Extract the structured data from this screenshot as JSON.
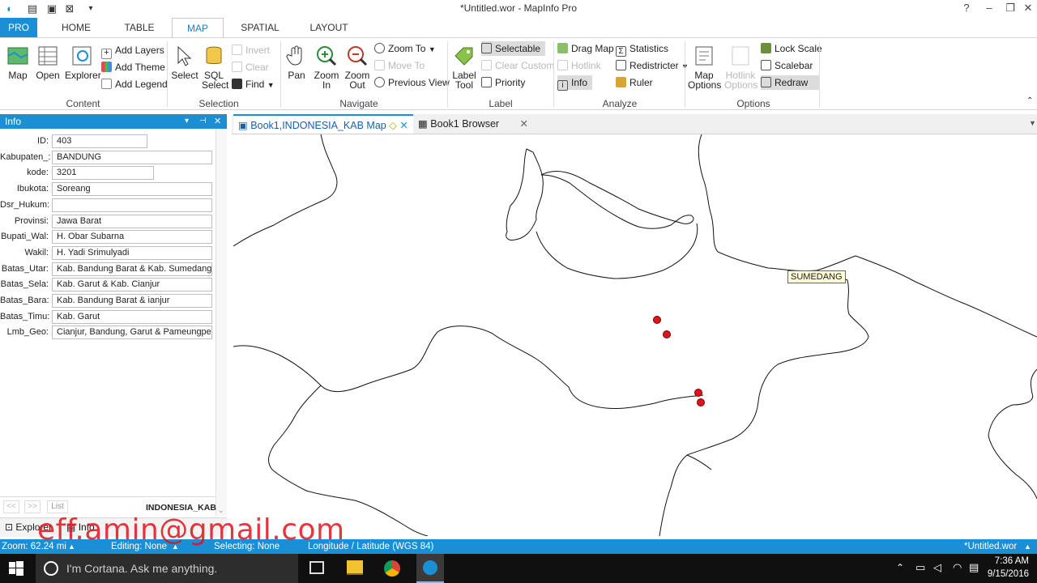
{
  "window": {
    "title": "*Untitled.wor - MapInfo Pro"
  },
  "ribbon_tabs": [
    "PRO",
    "HOME",
    "TABLE",
    "MAP",
    "SPATIAL",
    "LAYOUT"
  ],
  "ribbon": {
    "content": {
      "label": "Content",
      "map": "Map",
      "open": "Open",
      "explorer": "Explorer",
      "add_layers": "Add Layers",
      "add_theme": "Add Theme",
      "add_legend": "Add Legend"
    },
    "selection": {
      "label": "Selection",
      "select": "Select",
      "sql_select": "SQL Select",
      "invert": "Invert",
      "clear": "Clear",
      "find": "Find"
    },
    "navigate": {
      "label": "Navigate",
      "pan": "Pan",
      "zoom_in": "Zoom In",
      "zoom_out": "Zoom Out",
      "zoom_to": "Zoom To",
      "move_to": "Move To",
      "previous_view": "Previous View"
    },
    "label": {
      "label": "Label",
      "label_tool": "Label Tool",
      "selectable": "Selectable",
      "clear_custom": "Clear Custom",
      "priority": "Priority"
    },
    "analyze": {
      "label": "Analyze",
      "drag_map": "Drag Map",
      "hotlink": "Hotlink",
      "info": "Info",
      "statistics": "Statistics",
      "redistricter": "Redistricter",
      "ruler": "Ruler"
    },
    "options": {
      "label": "Options",
      "map_options": "Map Options",
      "hotlink_options": "Hotlink Options",
      "lock_scale": "Lock Scale",
      "scalebar": "Scalebar",
      "redraw": "Redraw"
    }
  },
  "info_panel": {
    "title": "Info",
    "fields": [
      {
        "label": "ID:",
        "value": "403"
      },
      {
        "label": "Kabupaten_:",
        "value": "BANDUNG"
      },
      {
        "label": "kode:",
        "value": "3201"
      },
      {
        "label": "Ibukota:",
        "value": "Soreang"
      },
      {
        "label": "Dsr_Hukum:",
        "value": ""
      },
      {
        "label": "Provinsi:",
        "value": "Jawa Barat"
      },
      {
        "label": "Bupati_Wal:",
        "value": "H. Obar Subarna"
      },
      {
        "label": "Wakil:",
        "value": "H. Yadi Srimulyadi"
      },
      {
        "label": "Batas_Utar:",
        "value": "Kab. Bandung Barat & Kab. Sumedang"
      },
      {
        "label": "Batas_Sela:",
        "value": "Kab. Garut & Kab. Cianjur"
      },
      {
        "label": "Batas_Bara:",
        "value": "Kab. Bandung Barat & ianjur"
      },
      {
        "label": "Batas_Timu:",
        "value": "Kab. Garut"
      },
      {
        "label": "Lmb_Geo:",
        "value": "Cianjur, Bandung, Garut & Pameungpeuk, S"
      }
    ],
    "nav_prev": "<<",
    "nav_next": ">>",
    "nav_list": "List",
    "table_name": "INDONESIA_KAB",
    "bottom_tabs": [
      "Explorer",
      "Info"
    ]
  },
  "doc_tabs": [
    {
      "label": "Book1,INDONESIA_KAB Map",
      "active": true
    },
    {
      "label": "Book1 Browser",
      "active": false
    }
  ],
  "map": {
    "label_sumedang": "SUMEDANG",
    "point_color": "#e0131b"
  },
  "status": {
    "zoom": "Zoom: 62.24 mi",
    "editing": "Editing: None",
    "selecting": "Selecting: None",
    "projection": "Longitude / Latitude (WGS 84)",
    "workspace": "*Untitled.wor"
  },
  "taskbar": {
    "cortana": "I'm Cortana. Ask me anything.",
    "time": "7:36 AM",
    "date": "9/15/2016"
  },
  "watermark": "eff.amin@gmail.com",
  "colors": {
    "accent": "#1b8fd6",
    "taskbar": "#101010"
  }
}
